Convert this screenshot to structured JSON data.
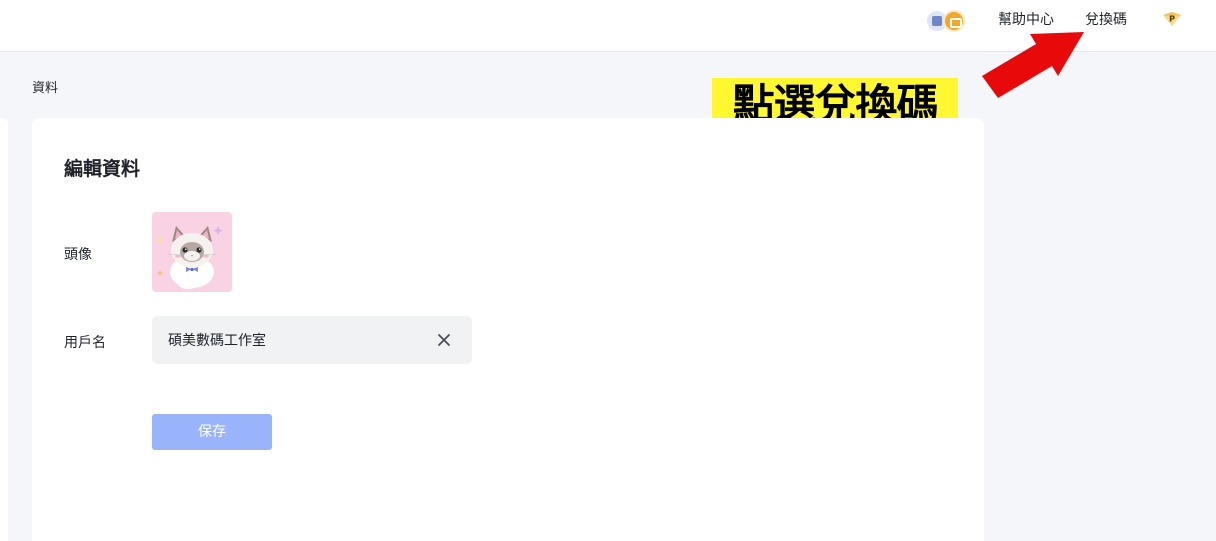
{
  "header": {
    "icons": [
      "ai-app-icon",
      "chat-bubble-icon"
    ],
    "help_label": "幫助中心",
    "redeem_label": "兌換碼",
    "premium_badge": "P",
    "premium_icon": "premium-p-badge-icon"
  },
  "annotation": {
    "text": "點選兌換碼",
    "arrow_color": "#e8090a",
    "highlight_color": "#fff830"
  },
  "breadcrumb": "資料",
  "profile_form": {
    "title": "編輯資料",
    "avatar_label": "頭像",
    "username_label": "用戶名",
    "username_value": "碩美數碼工作室",
    "clear_icon": "close-icon",
    "save_label": "保存"
  },
  "colors": {
    "background": "#f4f6f9",
    "card": "#ffffff",
    "save_button": "#99b4fb",
    "input_bg": "#f1f2f4"
  }
}
